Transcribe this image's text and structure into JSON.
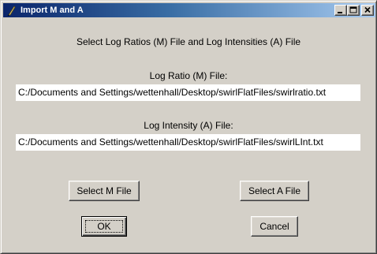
{
  "window": {
    "title": "Import M and A",
    "controls": {
      "minimize": "minimize",
      "maximize": "maximize",
      "close": "close"
    }
  },
  "main": {
    "heading": "Select Log Ratios (M) File and Log Intensities (A) File",
    "m_file": {
      "label": "Log Ratio (M) File:",
      "value": "C:/Documents and Settings/wettenhall/Desktop/swirlFlatFiles/swirlratio.txt"
    },
    "a_file": {
      "label": "Log Intensity (A) File:",
      "value": "C:/Documents and Settings/wettenhall/Desktop/swirlFlatFiles/swirlLInt.txt"
    },
    "buttons": {
      "select_m": "Select M File",
      "select_a": "Select A File",
      "ok": "OK",
      "cancel": "Cancel"
    }
  },
  "icons": {
    "title_icon": "feather-icon",
    "minimize": "minimize-icon",
    "maximize": "maximize-icon",
    "close": "close-icon"
  },
  "colors": {
    "face": "#d4d0c8",
    "titlebar_start": "#0a246a",
    "titlebar_end": "#a6caf0",
    "field_bg": "#ffffff"
  }
}
